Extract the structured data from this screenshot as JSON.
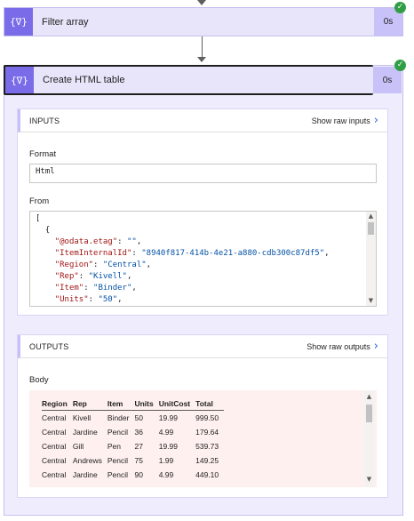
{
  "filter_card": {
    "title": "Filter array",
    "duration": "0s",
    "icon": "{∇}"
  },
  "html_card": {
    "title": "Create HTML table",
    "duration": "0s",
    "icon": "{∇}"
  },
  "inputs": {
    "title": "INPUTS",
    "show_raw": "Show raw inputs",
    "format_label": "Format",
    "format_value": "Html",
    "from_label": "From",
    "from_lines": [
      [
        {
          "t": "[",
          "c": "p"
        }
      ],
      [
        {
          "t": "  {",
          "c": "p"
        }
      ],
      [
        {
          "t": "    ",
          "c": "p"
        },
        {
          "t": "\"@odata.etag\"",
          "c": "k"
        },
        {
          "t": ": ",
          "c": "p"
        },
        {
          "t": "\"\"",
          "c": "s"
        },
        {
          "t": ",",
          "c": "p"
        }
      ],
      [
        {
          "t": "    ",
          "c": "p"
        },
        {
          "t": "\"ItemInternalId\"",
          "c": "k"
        },
        {
          "t": ": ",
          "c": "p"
        },
        {
          "t": "\"8940f817-414b-4e21-a880-cdb300c87df5\"",
          "c": "s"
        },
        {
          "t": ",",
          "c": "p"
        }
      ],
      [
        {
          "t": "    ",
          "c": "p"
        },
        {
          "t": "\"Region\"",
          "c": "k"
        },
        {
          "t": ": ",
          "c": "p"
        },
        {
          "t": "\"Central\"",
          "c": "s"
        },
        {
          "t": ",",
          "c": "p"
        }
      ],
      [
        {
          "t": "    ",
          "c": "p"
        },
        {
          "t": "\"Rep\"",
          "c": "k"
        },
        {
          "t": ": ",
          "c": "p"
        },
        {
          "t": "\"Kivell\"",
          "c": "s"
        },
        {
          "t": ",",
          "c": "p"
        }
      ],
      [
        {
          "t": "    ",
          "c": "p"
        },
        {
          "t": "\"Item\"",
          "c": "k"
        },
        {
          "t": ": ",
          "c": "p"
        },
        {
          "t": "\"Binder\"",
          "c": "s"
        },
        {
          "t": ",",
          "c": "p"
        }
      ],
      [
        {
          "t": "    ",
          "c": "p"
        },
        {
          "t": "\"Units\"",
          "c": "k"
        },
        {
          "t": ": ",
          "c": "p"
        },
        {
          "t": "\"50\"",
          "c": "s"
        },
        {
          "t": ",",
          "c": "p"
        }
      ]
    ]
  },
  "outputs": {
    "title": "OUTPUTS",
    "show_raw": "Show raw outputs",
    "body_label": "Body",
    "table": {
      "headers": [
        "Region",
        "Rep",
        "Item",
        "Units",
        "UnitCost",
        "Total"
      ],
      "rows": [
        [
          "Central",
          "Kivell",
          "Binder",
          "50",
          "19.99",
          "999.50"
        ],
        [
          "Central",
          "Jardine",
          "Pencil",
          "36",
          "4.99",
          "179.64"
        ],
        [
          "Central",
          "Gill",
          "Pen",
          "27",
          "19.99",
          "539.73"
        ],
        [
          "Central",
          "Andrews",
          "Pencil",
          "75",
          "1.99",
          "149.25"
        ],
        [
          "Central",
          "Jardine",
          "Pencil",
          "90",
          "4.99",
          "449.10"
        ]
      ]
    }
  },
  "colors": {
    "accent": "#7a6be8",
    "header_bg": "#e8e5fb",
    "success": "#2f9e44",
    "link": "#2b5fe0"
  }
}
